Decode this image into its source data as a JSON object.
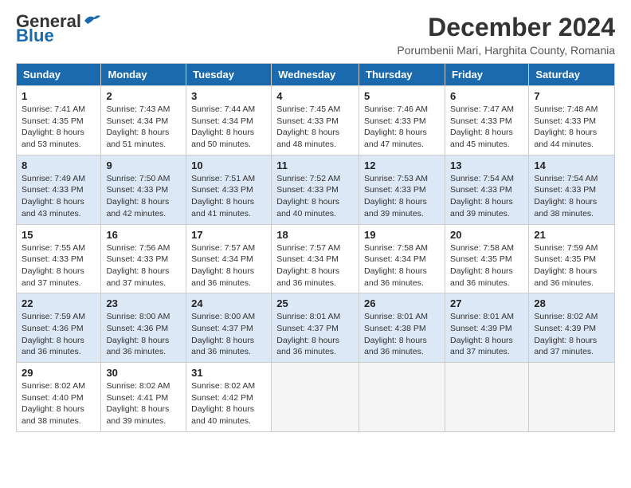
{
  "header": {
    "logo_line1": "General",
    "logo_line2": "Blue",
    "month": "December 2024",
    "location": "Porumbenii Mari, Harghita County, Romania"
  },
  "days_of_week": [
    "Sunday",
    "Monday",
    "Tuesday",
    "Wednesday",
    "Thursday",
    "Friday",
    "Saturday"
  ],
  "weeks": [
    [
      {
        "day": 1,
        "sunrise": "7:41 AM",
        "sunset": "4:35 PM",
        "daylight": "8 hours and 53 minutes"
      },
      {
        "day": 2,
        "sunrise": "7:43 AM",
        "sunset": "4:34 PM",
        "daylight": "8 hours and 51 minutes"
      },
      {
        "day": 3,
        "sunrise": "7:44 AM",
        "sunset": "4:34 PM",
        "daylight": "8 hours and 50 minutes"
      },
      {
        "day": 4,
        "sunrise": "7:45 AM",
        "sunset": "4:33 PM",
        "daylight": "8 hours and 48 minutes"
      },
      {
        "day": 5,
        "sunrise": "7:46 AM",
        "sunset": "4:33 PM",
        "daylight": "8 hours and 47 minutes"
      },
      {
        "day": 6,
        "sunrise": "7:47 AM",
        "sunset": "4:33 PM",
        "daylight": "8 hours and 45 minutes"
      },
      {
        "day": 7,
        "sunrise": "7:48 AM",
        "sunset": "4:33 PM",
        "daylight": "8 hours and 44 minutes"
      }
    ],
    [
      {
        "day": 8,
        "sunrise": "7:49 AM",
        "sunset": "4:33 PM",
        "daylight": "8 hours and 43 minutes"
      },
      {
        "day": 9,
        "sunrise": "7:50 AM",
        "sunset": "4:33 PM",
        "daylight": "8 hours and 42 minutes"
      },
      {
        "day": 10,
        "sunrise": "7:51 AM",
        "sunset": "4:33 PM",
        "daylight": "8 hours and 41 minutes"
      },
      {
        "day": 11,
        "sunrise": "7:52 AM",
        "sunset": "4:33 PM",
        "daylight": "8 hours and 40 minutes"
      },
      {
        "day": 12,
        "sunrise": "7:53 AM",
        "sunset": "4:33 PM",
        "daylight": "8 hours and 39 minutes"
      },
      {
        "day": 13,
        "sunrise": "7:54 AM",
        "sunset": "4:33 PM",
        "daylight": "8 hours and 39 minutes"
      },
      {
        "day": 14,
        "sunrise": "7:54 AM",
        "sunset": "4:33 PM",
        "daylight": "8 hours and 38 minutes"
      }
    ],
    [
      {
        "day": 15,
        "sunrise": "7:55 AM",
        "sunset": "4:33 PM",
        "daylight": "8 hours and 37 minutes"
      },
      {
        "day": 16,
        "sunrise": "7:56 AM",
        "sunset": "4:33 PM",
        "daylight": "8 hours and 37 minutes"
      },
      {
        "day": 17,
        "sunrise": "7:57 AM",
        "sunset": "4:34 PM",
        "daylight": "8 hours and 36 minutes"
      },
      {
        "day": 18,
        "sunrise": "7:57 AM",
        "sunset": "4:34 PM",
        "daylight": "8 hours and 36 minutes"
      },
      {
        "day": 19,
        "sunrise": "7:58 AM",
        "sunset": "4:34 PM",
        "daylight": "8 hours and 36 minutes"
      },
      {
        "day": 20,
        "sunrise": "7:58 AM",
        "sunset": "4:35 PM",
        "daylight": "8 hours and 36 minutes"
      },
      {
        "day": 21,
        "sunrise": "7:59 AM",
        "sunset": "4:35 PM",
        "daylight": "8 hours and 36 minutes"
      }
    ],
    [
      {
        "day": 22,
        "sunrise": "7:59 AM",
        "sunset": "4:36 PM",
        "daylight": "8 hours and 36 minutes"
      },
      {
        "day": 23,
        "sunrise": "8:00 AM",
        "sunset": "4:36 PM",
        "daylight": "8 hours and 36 minutes"
      },
      {
        "day": 24,
        "sunrise": "8:00 AM",
        "sunset": "4:37 PM",
        "daylight": "8 hours and 36 minutes"
      },
      {
        "day": 25,
        "sunrise": "8:01 AM",
        "sunset": "4:37 PM",
        "daylight": "8 hours and 36 minutes"
      },
      {
        "day": 26,
        "sunrise": "8:01 AM",
        "sunset": "4:38 PM",
        "daylight": "8 hours and 36 minutes"
      },
      {
        "day": 27,
        "sunrise": "8:01 AM",
        "sunset": "4:39 PM",
        "daylight": "8 hours and 37 minutes"
      },
      {
        "day": 28,
        "sunrise": "8:02 AM",
        "sunset": "4:39 PM",
        "daylight": "8 hours and 37 minutes"
      }
    ],
    [
      {
        "day": 29,
        "sunrise": "8:02 AM",
        "sunset": "4:40 PM",
        "daylight": "8 hours and 38 minutes"
      },
      {
        "day": 30,
        "sunrise": "8:02 AM",
        "sunset": "4:41 PM",
        "daylight": "8 hours and 39 minutes"
      },
      {
        "day": 31,
        "sunrise": "8:02 AM",
        "sunset": "4:42 PM",
        "daylight": "8 hours and 40 minutes"
      },
      null,
      null,
      null,
      null
    ]
  ]
}
